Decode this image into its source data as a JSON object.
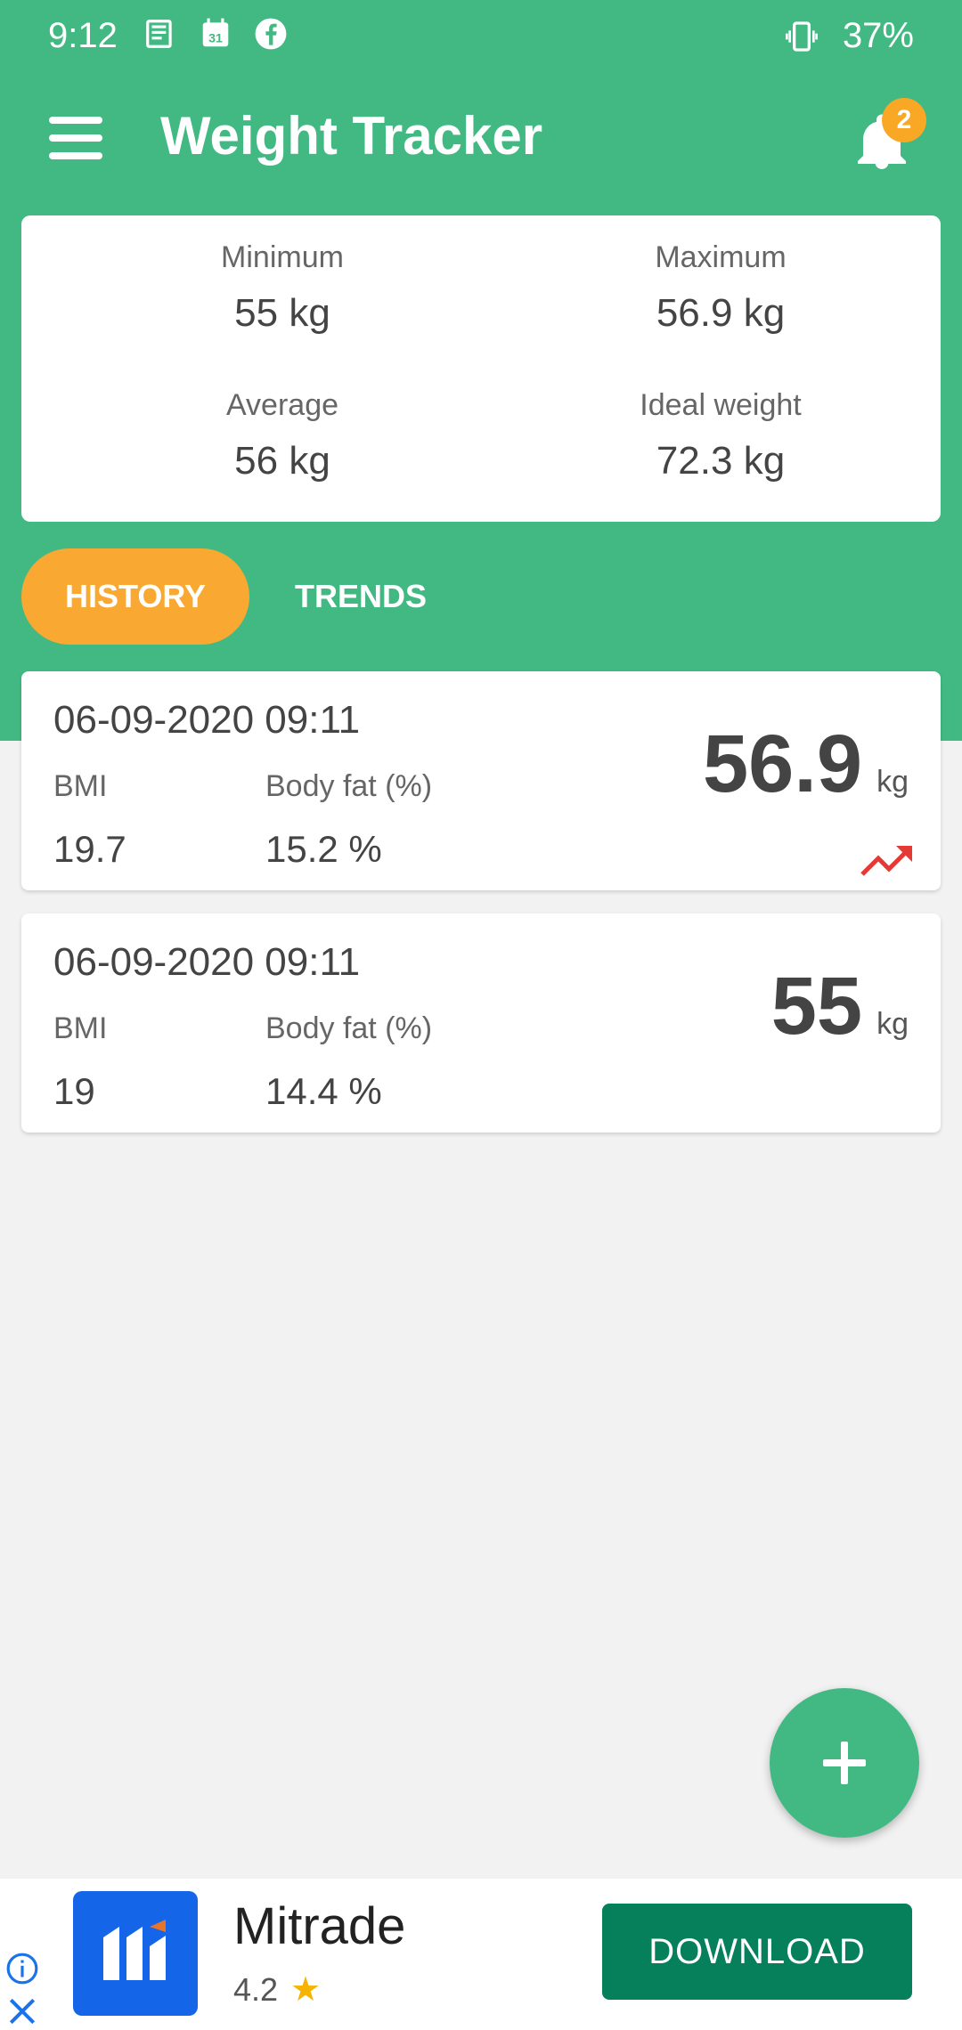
{
  "status_bar": {
    "time": "9:12",
    "battery": "37%",
    "icons": [
      "news-icon",
      "calendar-icon",
      "facebook-icon",
      "vibrate-icon"
    ],
    "calendar_day": "31"
  },
  "app_bar": {
    "title": "Weight Tracker",
    "notification_count": "2"
  },
  "stats": {
    "minimum": {
      "label": "Minimum",
      "value": "55 kg"
    },
    "maximum": {
      "label": "Maximum",
      "value": "56.9 kg"
    },
    "average": {
      "label": "Average",
      "value": "56 kg"
    },
    "ideal": {
      "label": "Ideal weight",
      "value": "72.3 kg"
    }
  },
  "tabs": {
    "history": "HISTORY",
    "trends": "TRENDS",
    "active": "history"
  },
  "entries": [
    {
      "date": "06-09-2020 09:11",
      "bmi_label": "BMI",
      "bmi": "19.7",
      "fat_label": "Body fat (%)",
      "fat": "15.2 %",
      "weight": "56.9",
      "unit": "kg",
      "trend": "up"
    },
    {
      "date": "06-09-2020 09:11",
      "bmi_label": "BMI",
      "bmi": "19",
      "fat_label": "Body fat (%)",
      "fat": "14.4 %",
      "weight": "55",
      "unit": "kg",
      "trend": "none"
    }
  ],
  "ad": {
    "name": "Mitrade",
    "rating": "4.2",
    "cta": "DOWNLOAD"
  },
  "colors": {
    "primary": "#42b983",
    "accent": "#f9a831",
    "trend_up": "#e53935",
    "ad_button": "#05805a",
    "ad_logo": "#1565e8"
  }
}
